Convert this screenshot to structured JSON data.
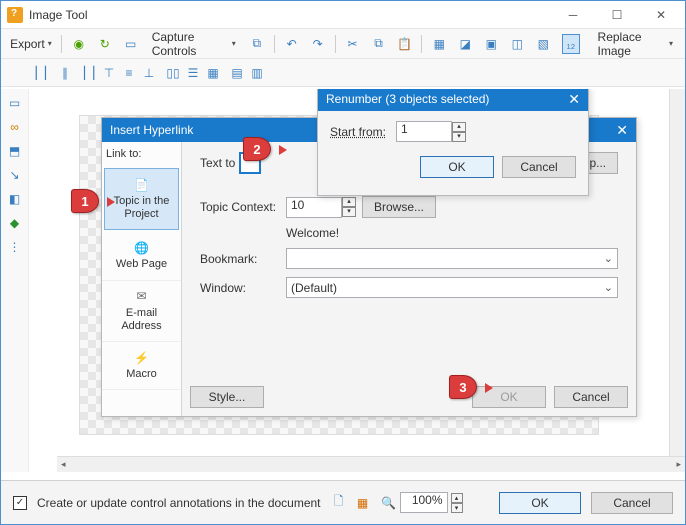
{
  "window": {
    "title": "Image Tool"
  },
  "toolbar": {
    "export": "Export",
    "capture_controls": "Capture Controls",
    "replace_image": "Replace Image"
  },
  "hyperlink": {
    "title": "Insert Hyperlink",
    "link_to": "Link to:",
    "text_to": "Text to",
    "topic_context": "Topic Context:",
    "topic_value": "10",
    "browse": "Browse...",
    "welcome": "Welcome!",
    "bookmark": "Bookmark:",
    "window_label": "Window:",
    "window_value": "(Default)",
    "style": "Style...",
    "ok": "OK",
    "cancel": "Cancel",
    "screen_tip": "reenTip...",
    "sidebar": {
      "topic": "Topic in the Project",
      "web": "Web Page",
      "email": "E-mail Address",
      "macro": "Macro"
    }
  },
  "renumber": {
    "title": "Renumber (3 objects selected)",
    "start_from": "Start from:",
    "value": "1",
    "ok": "OK",
    "cancel": "Cancel"
  },
  "callouts": {
    "c1": "1",
    "c2": "2",
    "c3": "3"
  },
  "statusbar": {
    "checkbox_label": "Create or update control annotations in the document",
    "zoom": "100%",
    "ok": "OK",
    "cancel": "Cancel"
  }
}
